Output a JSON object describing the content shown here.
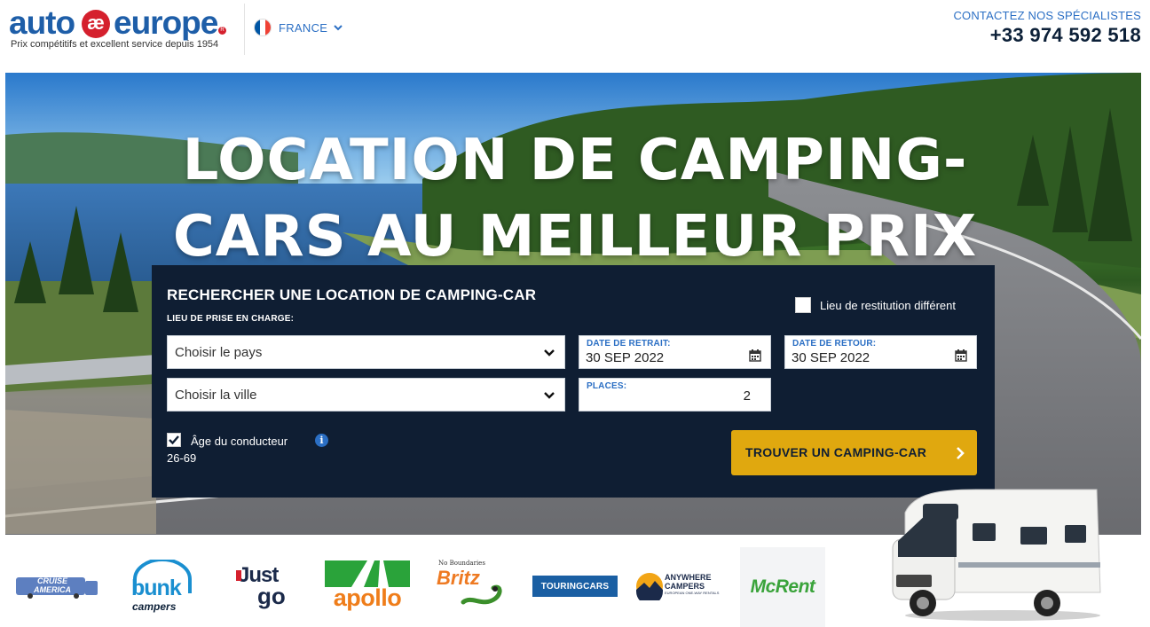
{
  "header": {
    "logo": {
      "word_left": "auto",
      "mark": "æ",
      "word_right": "europe",
      "reg": "R",
      "tagline": "Prix compétitifs et excellent service depuis 1954"
    },
    "country": {
      "label": "FRANCE",
      "flag_icon": "france-flag-icon",
      "flag_colors": [
        "#0055a4",
        "#ffffff",
        "#ef4135"
      ]
    },
    "contact": {
      "label": "CONTACTEZ NOS SPÉCIALISTES",
      "phone": "+33 974 592 518"
    }
  },
  "hero": {
    "title_line1": "LOCATION DE CAMPING-",
    "title_line2": "CARS AU MEILLEUR PRIX"
  },
  "search": {
    "title": "RECHERCHER UNE LOCATION DE CAMPING-CAR",
    "pickup_label": "LIEU DE PRISE EN CHARGE:",
    "different_return": {
      "label": "Lieu de restitution différent",
      "checked": false
    },
    "country_select": {
      "value": "Choisir le pays"
    },
    "city_select": {
      "value": "Choisir la ville"
    },
    "pickup_date": {
      "label": "DATE DE RETRAIT:",
      "value": "30 SEP 2022"
    },
    "return_date": {
      "label": "DATE DE RETOUR:",
      "value": "30 SEP 2022"
    },
    "places": {
      "label": "PLACES:",
      "value": "2"
    },
    "driver_age": {
      "label": "Âge du conducteur 26-69",
      "checked": true
    },
    "info_icon": "i",
    "submit_label": "TROUVER UN CAMPING-CAR",
    "accent_color": "#e0a80f"
  },
  "brands": {
    "cruise_america": {
      "line1": "CRUISE",
      "line2": "AMERICA"
    },
    "bunk": {
      "line1": "bunk",
      "line2": "campers"
    },
    "justgo": {
      "line1": "Just",
      "line2": "go"
    },
    "apollo": {
      "label": "apollo"
    },
    "britz": {
      "tag": "No Boundaries",
      "label": "Britz"
    },
    "touring_cars": {
      "label": "TOURINGCARS"
    },
    "anywhere": {
      "line1": "ANYWHERE",
      "line2": "CAMPERS",
      "line3": "EUROPEAN ONE-WAY RENTALS"
    },
    "mcrent": {
      "label": "McRent"
    }
  }
}
